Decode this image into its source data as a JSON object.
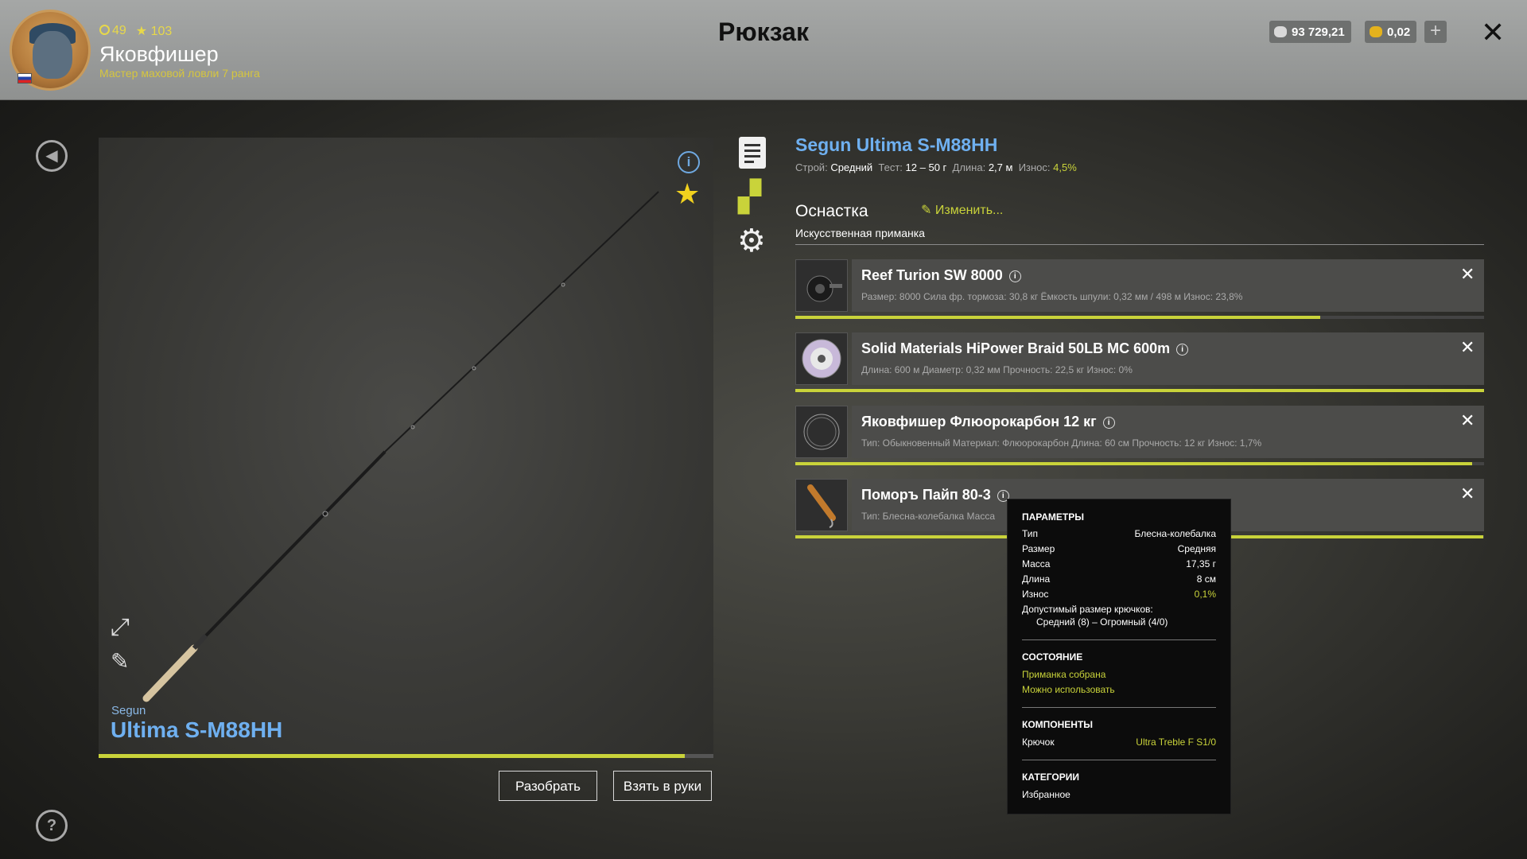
{
  "header": {
    "level": "49",
    "stars": "103",
    "username": "Яковфишер",
    "rank": "Мастер маховой ловли 7 ранга",
    "title": "Рюкзак",
    "silver": "93 729,21",
    "gold": "0,02",
    "plus": "+",
    "close": "✕"
  },
  "preview": {
    "brand": "Segun",
    "model": "Ultima S-M88HH",
    "wear": 0.953,
    "info": "i",
    "disassemble": "Разобрать",
    "take": "Взять в руки"
  },
  "item": {
    "title": "Segun Ultima S-M88HH",
    "stats": [
      {
        "label": "Строй:",
        "value": "Средний"
      },
      {
        "label": "Тест:",
        "value": "12 – 50 г"
      },
      {
        "label": "Длина:",
        "value": "2,7 м"
      },
      {
        "label": "Износ:",
        "value": "4,5%"
      }
    ]
  },
  "tackle": {
    "title": "Оснастка",
    "edit": "Изменить...",
    "subtitle": "Искусственная приманка",
    "slots": [
      {
        "name": "Reef Turion SW 8000",
        "stats": "Размер: 8000  Сила фр. тормоза: 30,8 кг  Ёмкость шпули: 0,32 мм / 498 м  Износ: 23,8%",
        "condition": 0.762
      },
      {
        "name": "Solid Materials HiPower Braid 50LB MC 600m",
        "stats": "Длина: 600 м  Диаметр: 0,32 мм  Прочность: 22,5 кг  Износ: 0%",
        "condition": 1.0
      },
      {
        "name": "Яковфишер Флюорокарбон 12 кг",
        "stats": "Тип: Обыкновенный  Материал: Флюорокарбон  Длина: 60 см  Прочность: 12 кг  Износ: 1,7%",
        "condition": 0.983
      },
      {
        "name": "Поморъ Пайп 80-3",
        "stats": "Тип: Блесна-колебалка  Масса",
        "condition": 0.999
      }
    ]
  },
  "tooltip": {
    "params_title": "ПАРАМЕТРЫ",
    "params": [
      {
        "label": "Тип",
        "value": "Блесна-колебалка"
      },
      {
        "label": "Размер",
        "value": "Средняя"
      },
      {
        "label": "Масса",
        "value": "17,35 г"
      },
      {
        "label": "Длина",
        "value": "8 см"
      },
      {
        "label": "Износ",
        "value": "0,1%"
      }
    ],
    "hook_size_label": "Допустимый размер крючков:",
    "hook_size_value": "Средний (8) – Огромный (4/0)",
    "state_title": "СОСТОЯНИЕ",
    "state_1": "Приманка собрана",
    "state_2": "Можно использовать",
    "components_title": "КОМПОНЕНТЫ",
    "component_label": "Крючок",
    "component_value": "Ultra Treble F S1/0",
    "categories_title": "КАТЕГОРИИ",
    "category": "Избранное"
  },
  "colors": {
    "accent_green": "#c9d33a",
    "accent_blue": "#6fb0f0",
    "star": "#f2d21e"
  }
}
